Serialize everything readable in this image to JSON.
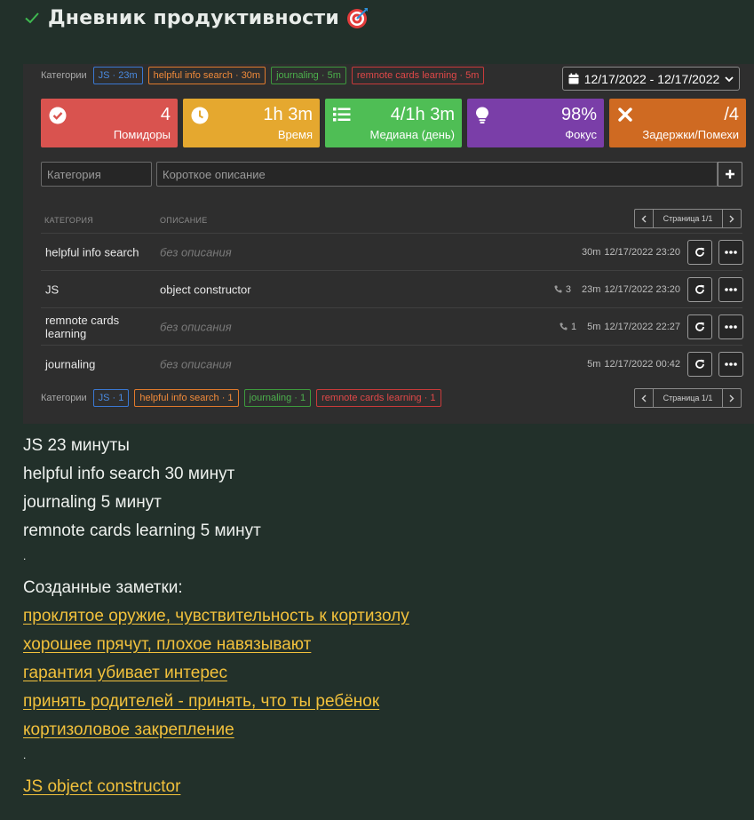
{
  "header": {
    "title": "Дневник продуктивности"
  },
  "widget": {
    "categories_label": "Категории",
    "top_tags": [
      {
        "text": "JS · 23m",
        "color": "blue"
      },
      {
        "text": "helpful info search · 30m",
        "color": "orange"
      },
      {
        "text": "journaling · 5m",
        "color": "green"
      },
      {
        "text": "remnote cards learning · 5m",
        "color": "red"
      }
    ],
    "date_range": "12/17/2022 - 12/17/2022",
    "stats": [
      {
        "value": "4",
        "label": "Помидоры",
        "color": "#d9534f",
        "icon": "check-circle-icon"
      },
      {
        "value": "1h 3m",
        "label": "Время",
        "color": "#e5a82f",
        "icon": "clock-icon"
      },
      {
        "value": "4/1h 3m",
        "label": "Медиана (день)",
        "color": "#4fbe55",
        "icon": "list-icon"
      },
      {
        "value": "98%",
        "label": "Фокус",
        "color": "#7a3ea8",
        "icon": "lightbulb-icon"
      },
      {
        "value": "/4",
        "label": "Задержки/Помехи",
        "color": "#cf6a22",
        "icon": "x-icon"
      }
    ],
    "category_placeholder": "Категория",
    "description_placeholder": "Короткое описание",
    "table": {
      "col_category": "КАТЕГОРИЯ",
      "col_description": "ОПИСАНИЕ",
      "page_info": "Страница 1/1",
      "rows": [
        {
          "category": "helpful info search",
          "description": "без описания",
          "empty": true,
          "interruptions": "",
          "duration": "30m",
          "datetime": "12/17/2022 23:20"
        },
        {
          "category": "JS",
          "description": "object constructor",
          "empty": false,
          "interruptions": "3",
          "duration": "23m",
          "datetime": "12/17/2022 23:20"
        },
        {
          "category": "remnote cards learning",
          "description": "без описания",
          "empty": true,
          "interruptions": "1",
          "duration": "5m",
          "datetime": "12/17/2022 22:27"
        },
        {
          "category": "journaling",
          "description": "без описания",
          "empty": true,
          "interruptions": "",
          "duration": "5m",
          "datetime": "12/17/2022 00:42"
        }
      ]
    },
    "bottom_tags": [
      {
        "text": "JS · 1",
        "color": "blue"
      },
      {
        "text": "helpful info search · 1",
        "color": "orange"
      },
      {
        "text": "journaling · 1",
        "color": "green"
      },
      {
        "text": "remnote cards learning · 1",
        "color": "red"
      }
    ]
  },
  "summary": [
    "JS 23 минуты",
    "helpful info search 30 минут",
    "journaling 5 минут",
    "remnote cards learning 5 минут"
  ],
  "separator": ".",
  "notes_heading": "Созданные заметки:",
  "note_links": [
    "проклятое оружие, чувствительность к кортизолу",
    "хорошее прячут, плохое навязывают",
    "гарантия убивает интерес",
    "принять родителей - принять, что ты ребёнок",
    "кортизоловое закрепление"
  ],
  "extra_link": "JS object constructor"
}
